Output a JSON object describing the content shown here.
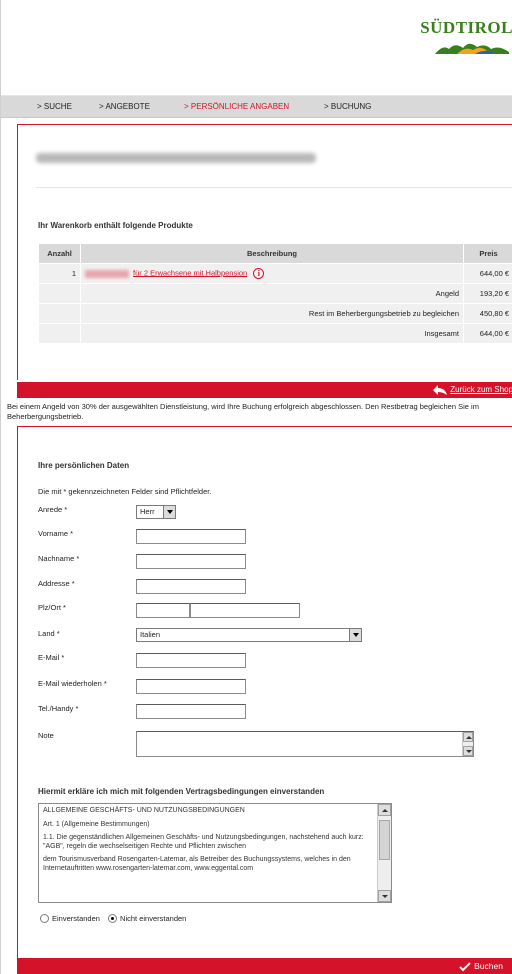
{
  "header": {
    "logo_text": "SÜDTIROL",
    "colors": {
      "brand_red": "#d4132a",
      "logo_green": "#3a7f1e",
      "logo_orange": "#f2a31b"
    }
  },
  "nav": {
    "items": [
      {
        "label": "> Suche",
        "active": false
      },
      {
        "label": "> Angebote",
        "active": false
      },
      {
        "label": "> Persönliche Angaben",
        "active": true
      },
      {
        "label": "> Buchung",
        "active": false
      }
    ]
  },
  "cart": {
    "title": "Ihr Warenkorb enthält folgende Produkte",
    "columns": [
      "Anzahl",
      "Beschreibung",
      "Preis"
    ],
    "item": {
      "qty": "1",
      "description": "für 2 Erwachsene mit Halbpension",
      "price": "644,00 €",
      "icon": "info-icon"
    },
    "summary": [
      {
        "label": "Angeld",
        "value": "193,20 €"
      },
      {
        "label": "Rest im Beherbergungsbetrieb zu begleichen",
        "value": "450,80 €"
      },
      {
        "label": "Insgesamt",
        "value": "644,00 €"
      }
    ]
  },
  "back_link": {
    "label": "Zurück zum Shop",
    "icon": "back-arrow-icon"
  },
  "info_text": "Bei einem Angeld von 30% der ausgewählten Dienstleistung, wird Ihre Buchung erfolgreich abgeschlossen. Den Restbetrag begleichen Sie im Beherbergungsbetrieb.",
  "personal": {
    "title": "Ihre persönlichen Daten",
    "required_note": "Die mit * gekennzeichneten Felder sind Pflichtfelder.",
    "fields": {
      "salutation": {
        "label": "Anrede *",
        "value": "Herr"
      },
      "firstname": {
        "label": "Vorname *",
        "value": ""
      },
      "lastname": {
        "label": "Nachname *",
        "value": ""
      },
      "address": {
        "label": "Addresse *",
        "value": ""
      },
      "zipcity": {
        "label": "Plz/Ort *",
        "zip": "",
        "city": ""
      },
      "country": {
        "label": "Land *",
        "value": "Italien"
      },
      "email": {
        "label": "E-Mail *",
        "value": ""
      },
      "email_repeat": {
        "label": "E-Mail wiederholen *",
        "value": ""
      },
      "phone": {
        "label": "Tel./Handy *",
        "value": ""
      },
      "note": {
        "label": "Note",
        "value": ""
      }
    }
  },
  "terms": {
    "title": "Hiermit erkläre ich mich mit folgenden Vertragsbedingungen einverstanden",
    "lines": [
      "ALLGEMEINE GESCHÄFTS- UND NUTZUNGSBEDINGUNGEN",
      "Art. 1 (Allgemeine Bestimmungen)",
      "1.1. Die gegenständlichen Allgemeinen Geschäfts- und Nutzungsbedingungen, nachstehend auch kurz: \"AGB\", regeln die wechselseitigen Rechte und Pflichten zwischen",
      "dem Tourismusverband Rosengarten-Latemar, als Betreiber des Buchungssystems, welches in den Internetauftritten www.rosengarten-latemar.com, www.eggental.com"
    ],
    "agree_label": "Einverstanden",
    "disagree_label": "Nicht einverstanden",
    "selected": "disagree"
  },
  "book_button": {
    "label": "Buchen",
    "icon": "checkmark-icon"
  }
}
